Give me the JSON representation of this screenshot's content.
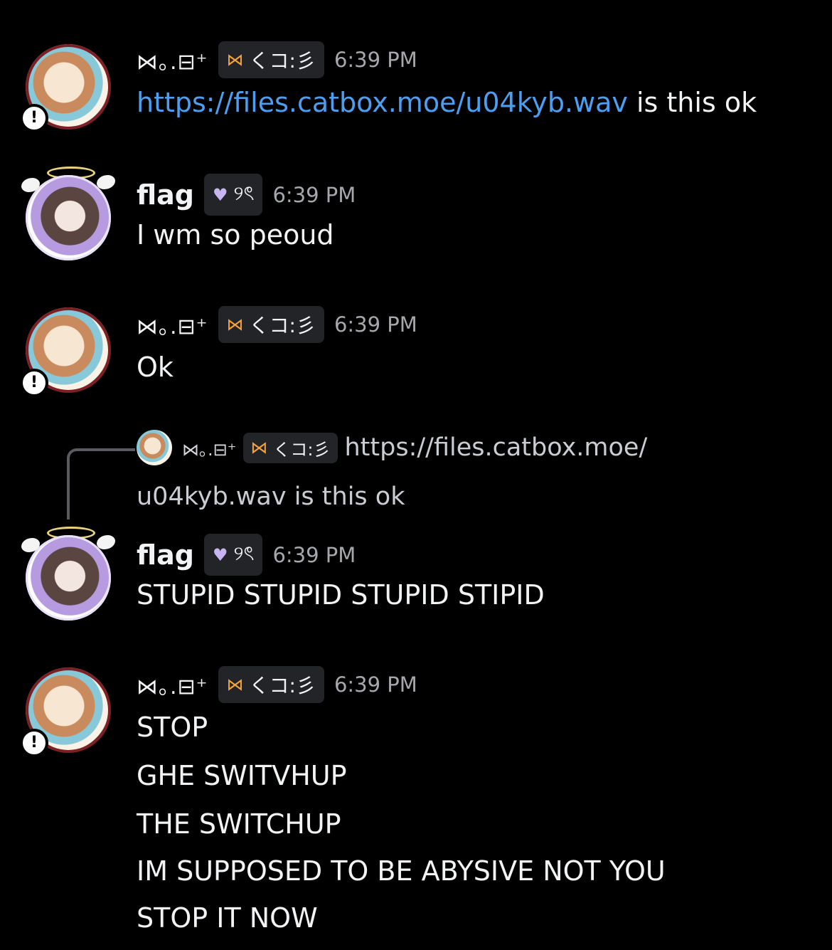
{
  "messages": [
    {
      "author": "⋈｡.⊟⁺",
      "tag_icon": "butterfly-icon",
      "tag_text": "くコ:彡",
      "time": "6:39 PM",
      "link": "https://files.catbox.moe/u04kyb.wav",
      "text": " is this ok"
    },
    {
      "author": "flag",
      "tag_icon": "heart-icon",
      "tag_text": "୨ৎ",
      "time": "6:39 PM",
      "text": "I wm so peoud"
    },
    {
      "author": "⋈｡.⊟⁺",
      "tag_icon": "butterfly-icon",
      "tag_text": "くコ:彡",
      "time": "6:39 PM",
      "text": "Ok"
    },
    {
      "reply": {
        "author": "⋈｡.⊟⁺",
        "tag_text": "くコ:彡",
        "text_line1": "https://files.catbox.moe/",
        "text_line2": "u04kyb.wav is this ok"
      },
      "author": "flag",
      "tag_icon": "heart-icon",
      "tag_text": "୨ৎ",
      "time": "6:39 PM",
      "text": "STUPID STUPID STUPID STIPID"
    },
    {
      "author": "⋈｡.⊟⁺",
      "tag_icon": "butterfly-icon",
      "tag_text": "くコ:彡",
      "time": "6:39 PM",
      "lines": [
        "STOP",
        "GHE SWITVHUP",
        "THE SWITCHUP",
        "IM SUPPOSED TO BE ABYSIVE NOT YOU",
        "STOP IT NOW"
      ]
    }
  ]
}
